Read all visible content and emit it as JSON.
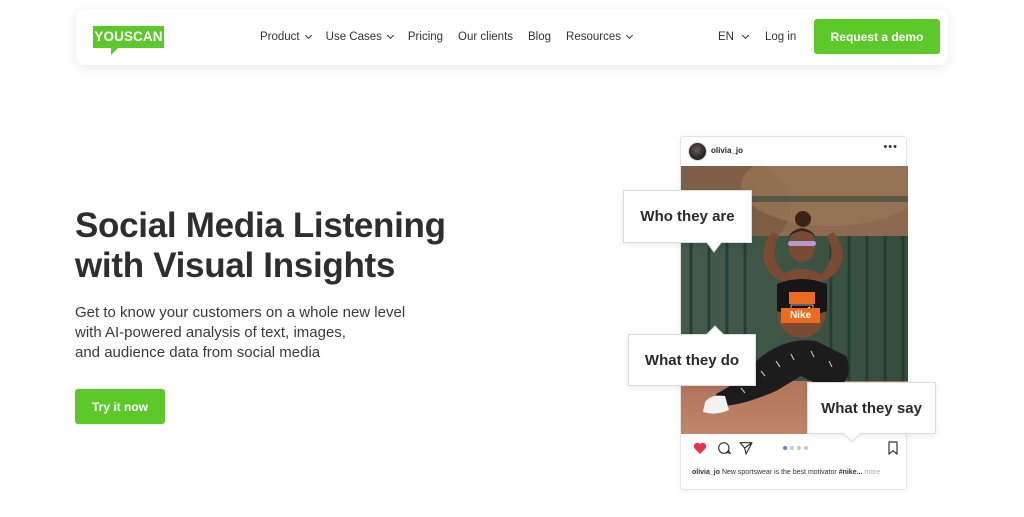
{
  "header": {
    "logo": "YOUSCAN",
    "nav": [
      {
        "label": "Product",
        "dropdown": true
      },
      {
        "label": "Use Cases",
        "dropdown": true
      },
      {
        "label": "Pricing",
        "dropdown": false
      },
      {
        "label": "Our clients",
        "dropdown": false
      },
      {
        "label": "Blog",
        "dropdown": false
      },
      {
        "label": "Resources",
        "dropdown": true
      }
    ],
    "lang": "EN",
    "login": "Log in",
    "demo_button": "Request a demo"
  },
  "hero": {
    "title_line1": "Social Media Listening",
    "title_line2": "with Visual Insights",
    "subtitle_line1": "Get to know your customers on a whole new level",
    "subtitle_line2": "with AI-powered analysis of text, images,",
    "subtitle_line3": "and audience data from social media",
    "cta": "Try it now"
  },
  "post": {
    "username": "olivia_jo",
    "more_icon": "ellipsis-icon",
    "top_label": "Nike",
    "caption_user": "olivia_jo",
    "caption_text": "New sportswear is the best motivator",
    "caption_tag": "#nike...",
    "caption_more": "more"
  },
  "callouts": {
    "who": "Who they are",
    "do": "What they do",
    "say": "What they say"
  },
  "colors": {
    "brand_green": "#5cc829",
    "heart_red": "#e8334a",
    "nike_orange": "#ee6a1f"
  }
}
